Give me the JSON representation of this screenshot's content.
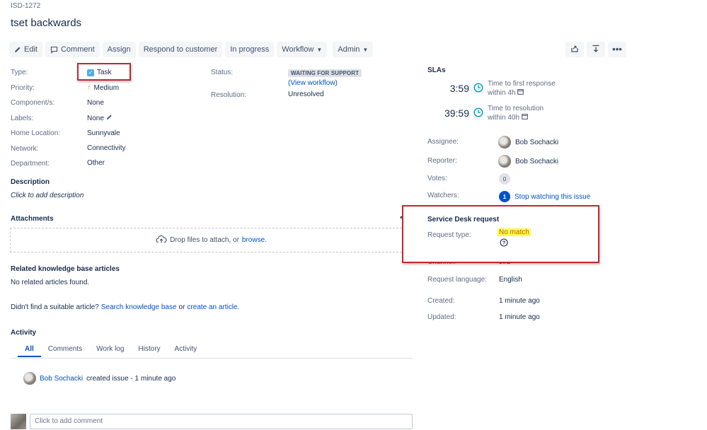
{
  "issue": {
    "key": "ISD-1272",
    "title": "tset backwards"
  },
  "toolbar": {
    "edit": "Edit",
    "comment": "Comment",
    "assign": "Assign",
    "respond": "Respond to customer",
    "in_progress": "In progress",
    "workflow": "Workflow",
    "admin": "Admin"
  },
  "details": {
    "type_label": "Type:",
    "type_value": "Task",
    "priority_label": "Priority:",
    "priority_value": "Medium",
    "components_label": "Component/s:",
    "components_value": "None",
    "labels_label": "Labels:",
    "labels_value": "None",
    "home_location_label": "Home Location:",
    "home_location_value": "Sunnyvale",
    "network_label": "Network:",
    "network_value": "Connectivity",
    "department_label": "Department:",
    "department_value": "Other",
    "status_label": "Status:",
    "status_value": "WAITING FOR SUPPORT",
    "view_workflow": "(View workflow)",
    "resolution_label": "Resolution:",
    "resolution_value": "Unresolved"
  },
  "description": {
    "heading": "Description",
    "placeholder": "Click to add description"
  },
  "attachments": {
    "heading": "Attachments",
    "drop_text": "Drop files to attach, or",
    "browse": "browse."
  },
  "kb": {
    "heading": "Related knowledge base articles",
    "empty": "No related articles found.",
    "prompt": "Didn't find a suitable article?",
    "search_link": "Search knowledge base",
    "or": "or",
    "create_link": "create an article."
  },
  "activity": {
    "heading": "Activity",
    "tabs": [
      "All",
      "Comments",
      "Work log",
      "History",
      "Activity"
    ],
    "entry_user": "Bob Sochacki",
    "entry_text": "created issue - 1 minute ago",
    "comment_placeholder": "Click to add comment"
  },
  "sla": {
    "heading": "SLAs",
    "items": [
      {
        "time": "3:59",
        "name": "Time to first response",
        "goal": "within 4h"
      },
      {
        "time": "39:59",
        "name": "Time to resolution",
        "goal": "within 40h"
      }
    ]
  },
  "people": {
    "assignee_label": "Assignee:",
    "assignee_value": "Bob Sochacki",
    "reporter_label": "Reporter:",
    "reporter_value": "Bob Sochacki",
    "votes_label": "Votes:",
    "votes_value": "0",
    "watchers_label": "Watchers:",
    "watchers_count": "1",
    "watch_link": "Stop watching this issue"
  },
  "service_desk": {
    "heading": "Service Desk request",
    "request_type_label": "Request type:",
    "request_type_value": "No match",
    "channel_label": "Channel:",
    "channel_value": "Jira",
    "language_label": "Request language:",
    "language_value": "English"
  },
  "dates": {
    "created_label": "Created:",
    "created_value": "1 minute ago",
    "updated_label": "Updated:",
    "updated_value": "1 minute ago"
  },
  "colors": {
    "link": "#0052cc",
    "annotation_red": "#c0282f",
    "highlight_yellow": "#fff94f",
    "sla_clock": "#00a3bf"
  }
}
